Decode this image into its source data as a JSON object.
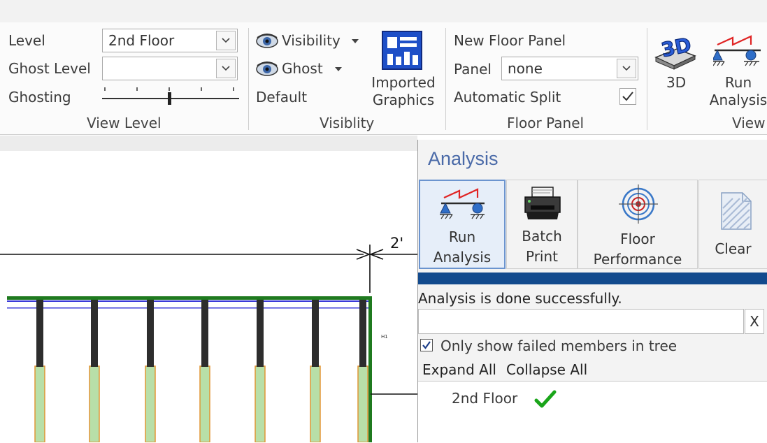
{
  "ribbon": {
    "view_level": {
      "level_label": "Level",
      "level_value": "2nd Floor",
      "ghost_level_label": "Ghost Level",
      "ghost_level_value": "",
      "ghosting_label": "Ghosting",
      "group_label": "View Level"
    },
    "visibility": {
      "visibility_label": "Visibility",
      "ghost_label": "Ghost",
      "default_label": "Default",
      "imported_graphics_line1": "Imported",
      "imported_graphics_line2": "Graphics",
      "group_label": "Visiblity"
    },
    "floor_panel": {
      "new_floor_panel_label": "New Floor Panel",
      "panel_label": "Panel",
      "panel_value": "none",
      "automatic_split_label": "Automatic Split",
      "automatic_split_checked": true,
      "group_label": "Floor Panel"
    },
    "view": {
      "threed_label": "3D",
      "run_analysis_line1": "Run",
      "run_analysis_line2": "Analysis",
      "group_label": "View"
    }
  },
  "drawing": {
    "dimension_label": "2'"
  },
  "analysis_panel": {
    "title": "Analysis",
    "buttons": [
      {
        "line1": "Run",
        "line2": "Analysis"
      },
      {
        "line1": "Batch",
        "line2": "Print"
      },
      {
        "line1": "Floor",
        "line2": "Performance"
      },
      {
        "line1": "Clear"
      }
    ],
    "status": "Analysis is done successfully.",
    "filter_value": "",
    "clear_filter_label": "X",
    "only_failed_label": "Only show failed members in tree",
    "only_failed_checked": true,
    "expand_all": "Expand All",
    "collapse_all": "Collapse All",
    "tree": [
      {
        "label": "2nd Floor",
        "status": "passed"
      }
    ]
  },
  "colors": {
    "progress": "#124a8d",
    "panel_title": "#4a6aa8",
    "check_ok": "#1aa51a",
    "beam_green": "#1f7a1f",
    "joist_fill": "#b8dfa8",
    "joist_edge": "#e0902a",
    "plate_blue": "#3a3ad8"
  }
}
